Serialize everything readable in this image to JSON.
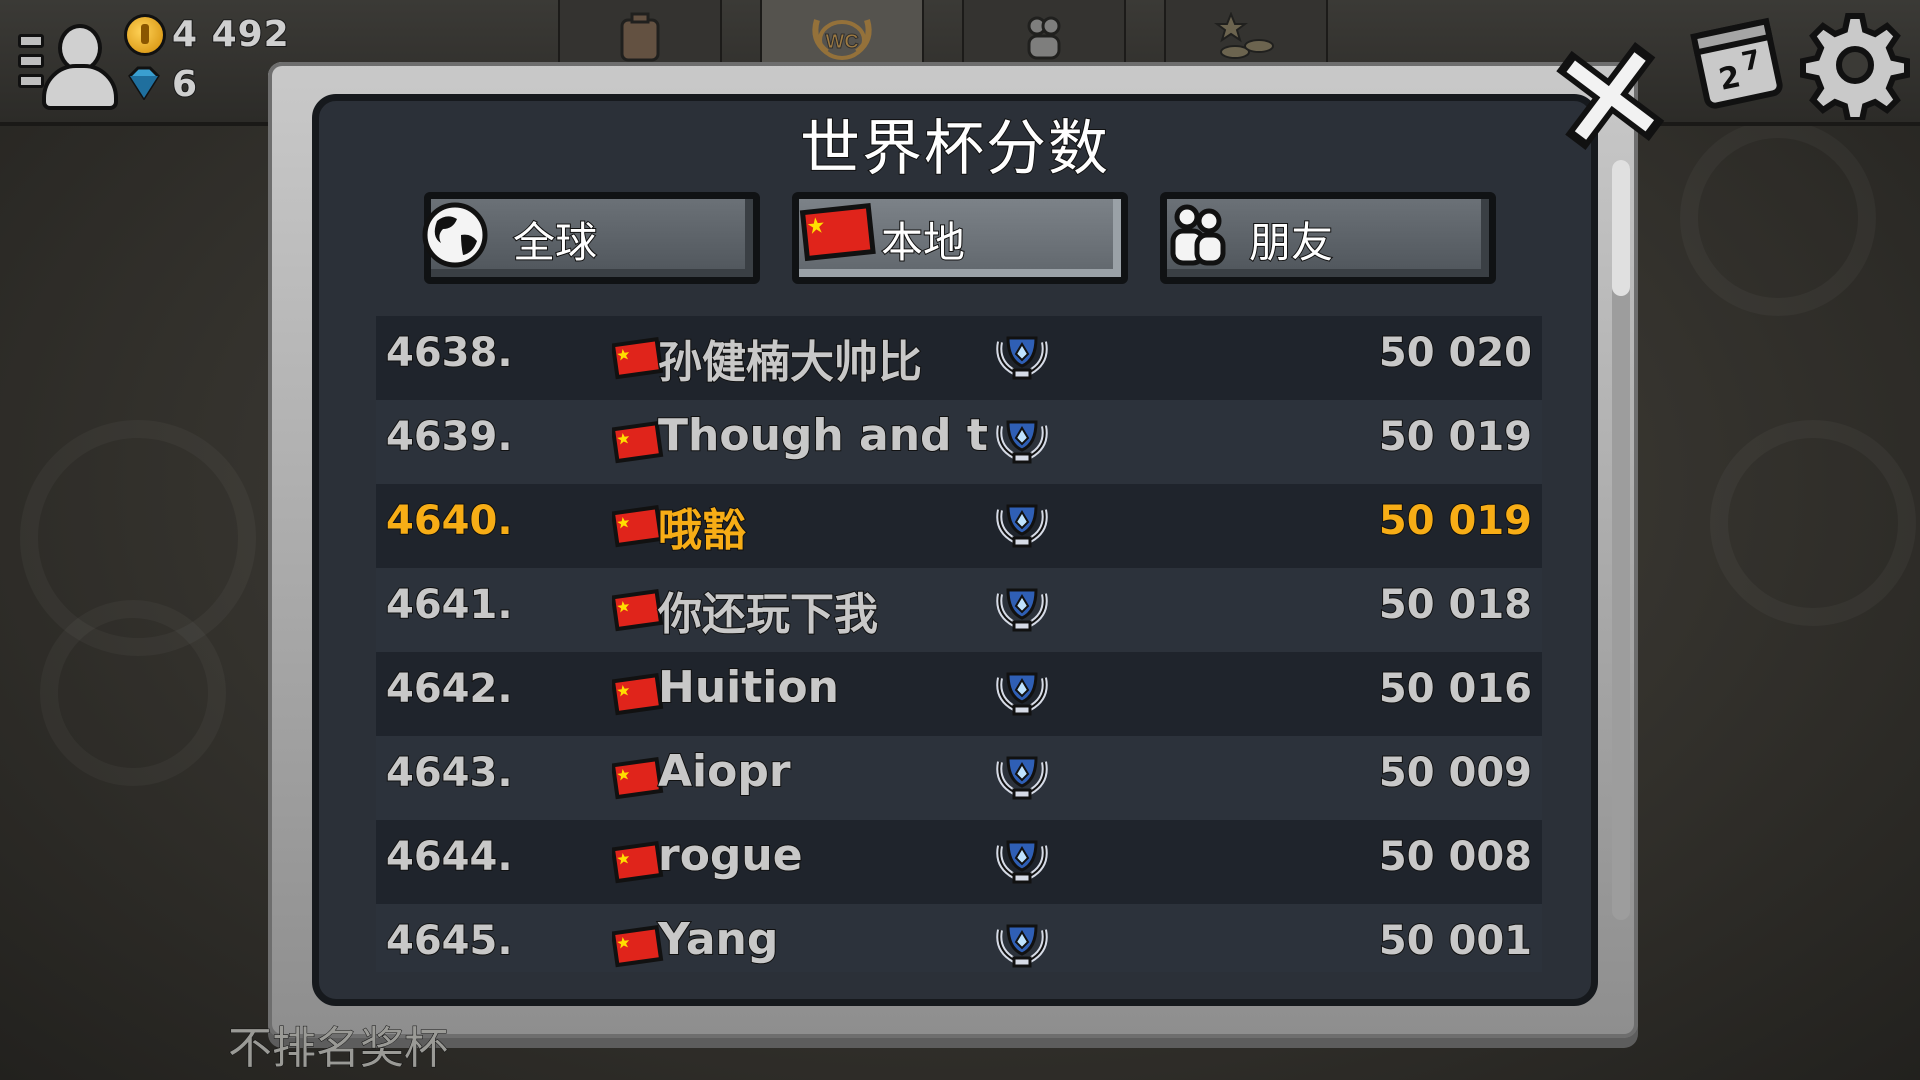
{
  "topbar": {
    "coins": "4 492",
    "gems": "6",
    "tabs": [
      {
        "icon": "fuel-can-icon",
        "active": false
      },
      {
        "icon": "world-cup-icon",
        "text": "WC",
        "active": true
      },
      {
        "icon": "friends-icon",
        "active": false
      },
      {
        "icon": "rewards-icon",
        "active": false
      }
    ],
    "right_icons": [
      "calendar-icon",
      "settings-gear-icon"
    ]
  },
  "dialog": {
    "title": "世界杯分数",
    "tabs": [
      {
        "label": "全球",
        "icon": "globe-icon",
        "active": false
      },
      {
        "label": "本地",
        "icon": "china-flag-icon",
        "active": true
      },
      {
        "label": "朋友",
        "icon": "friends-icon",
        "active": false
      }
    ],
    "rows": [
      {
        "rank": "4638.",
        "name": "孙健楠大帅比",
        "score": "50 020",
        "highlight": false
      },
      {
        "rank": "4639.",
        "name": "Though and t",
        "score": "50 019",
        "highlight": false
      },
      {
        "rank": "4640.",
        "name": "哦豁",
        "score": "50 019",
        "highlight": true
      },
      {
        "rank": "4641.",
        "name": "你还玩下我",
        "score": "50 018",
        "highlight": false
      },
      {
        "rank": "4642.",
        "name": "Huition",
        "score": "50 016",
        "highlight": false
      },
      {
        "rank": "4643.",
        "name": "Aiopr",
        "score": "50 009",
        "highlight": false
      },
      {
        "rank": "4644.",
        "name": "rogue",
        "score": "50 008",
        "highlight": false
      },
      {
        "rank": "4645.",
        "name": "Yang",
        "score": "50 001",
        "highlight": false
      }
    ]
  },
  "footer_text": "不排名奖杯",
  "colors": {
    "highlight": "#f7ad16",
    "row_text": "#c8c8c8",
    "panel": "#2b3038",
    "flag_red": "#e0241b",
    "flag_star": "#ffde00"
  }
}
